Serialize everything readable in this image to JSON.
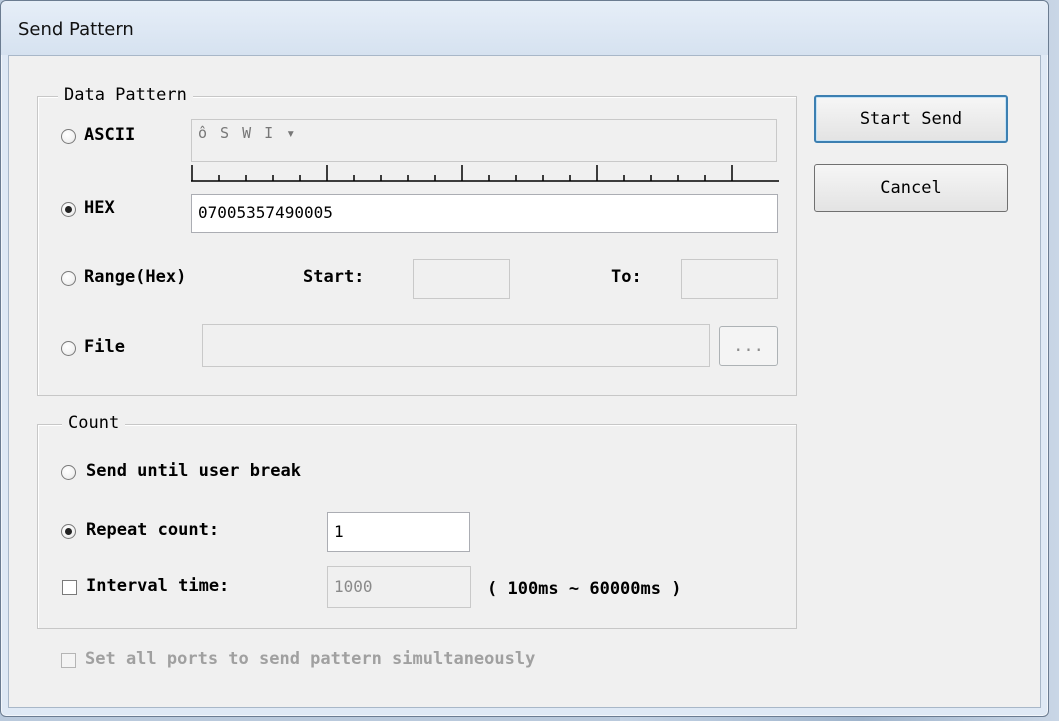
{
  "window": {
    "title": "Send Pattern"
  },
  "buttons": {
    "start_send": "Start Send",
    "cancel": "Cancel",
    "browse": "..."
  },
  "data_pattern": {
    "legend": "Data Pattern",
    "ascii": {
      "label": "ASCII",
      "selected": false,
      "value": "ô  S W I  ▾"
    },
    "hex": {
      "label": "HEX",
      "selected": true,
      "value": "07005357490005"
    },
    "range": {
      "label": "Range(Hex)",
      "selected": false,
      "start_label": "Start:",
      "to_label": "To:",
      "start_value": "",
      "to_value": ""
    },
    "file": {
      "label": "File",
      "selected": false,
      "value": ""
    }
  },
  "count": {
    "legend": "Count",
    "until_break": {
      "label": "Send until user break",
      "selected": false
    },
    "repeat": {
      "label": "Repeat count:",
      "selected": true,
      "value": "1"
    },
    "interval": {
      "label": "Interval time:",
      "checked": false,
      "value": "1000",
      "range_hint": "( 100ms ~ 60000ms )"
    }
  },
  "all_ports": {
    "label": "Set all ports to send pattern simultaneously",
    "checked": false,
    "enabled": false
  }
}
